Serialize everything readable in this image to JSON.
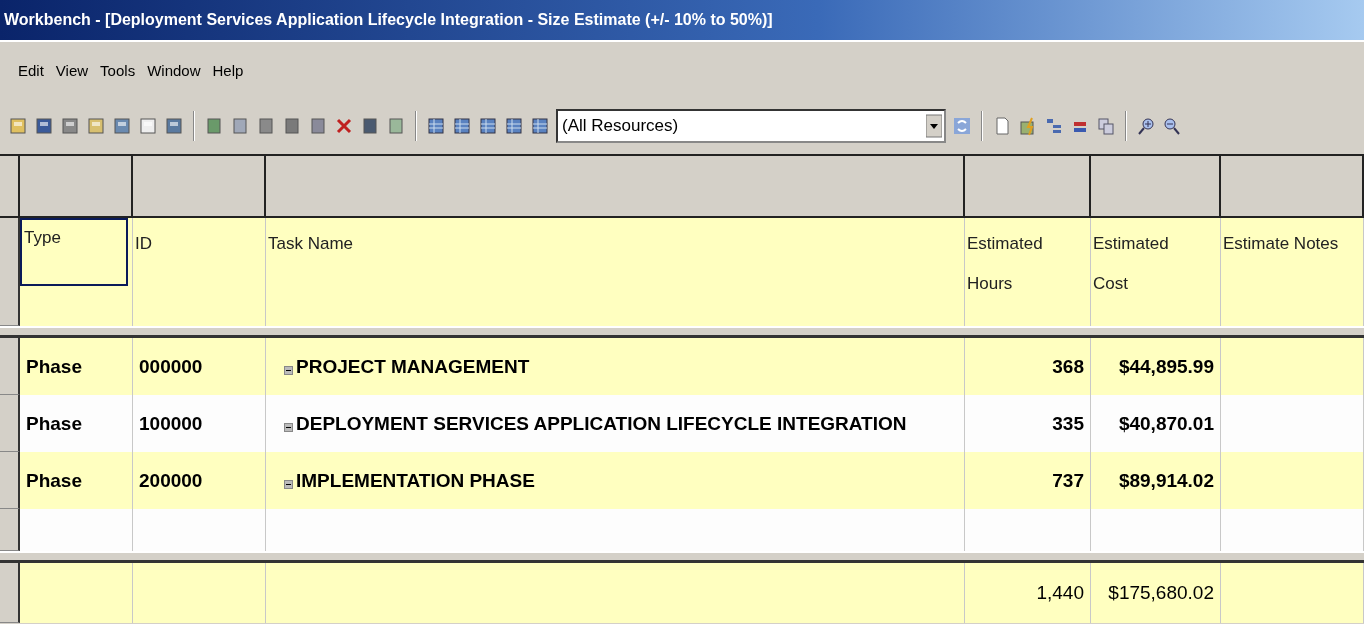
{
  "window": {
    "title": "Workbench - [Deployment Services Application Lifecycle Integration - Size Estimate (+/- 10% to 50%)]"
  },
  "menu": [
    "Edit",
    "View",
    "Tools",
    "Window",
    "Help"
  ],
  "toolbar": {
    "resource_filter": {
      "value": "(All Resources)"
    }
  },
  "table": {
    "columns": [
      {
        "label": "Type",
        "selected": true
      },
      {
        "label": "ID",
        "selected": false
      },
      {
        "label": "Task Name",
        "selected": false
      },
      {
        "label": "Estimated\nHours",
        "selected": false
      },
      {
        "label": "Estimated\nCost",
        "selected": false
      },
      {
        "label": "Estimate Notes",
        "selected": false
      }
    ],
    "rows": [
      {
        "type": "Phase",
        "id": "000000",
        "task": "PROJECT MANAGEMENT",
        "expanded": true,
        "hours": "368",
        "cost": "$44,895.99"
      },
      {
        "type": "Phase",
        "id": "100000",
        "task": "DEPLOYMENT SERVICES APPLICATION LIFECYCLE INTEGRATION",
        "expanded": true,
        "hours": "335",
        "cost": "$40,870.01"
      },
      {
        "type": "Phase",
        "id": "200000",
        "task": "IMPLEMENTATION PHASE",
        "expanded": true,
        "hours": "737",
        "cost": "$89,914.02"
      }
    ],
    "totals": {
      "hours": "1,440",
      "cost": "$175,680.02"
    }
  }
}
